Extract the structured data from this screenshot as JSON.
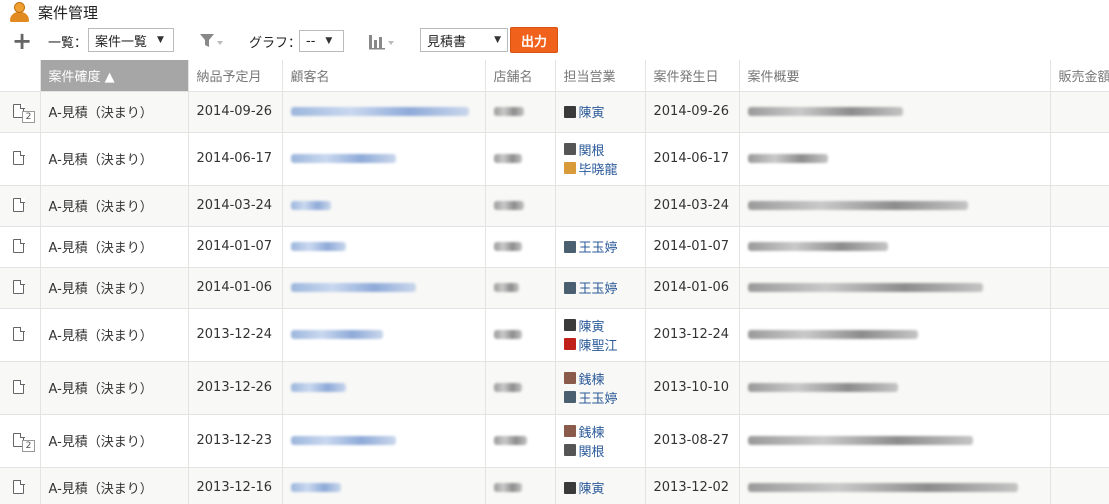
{
  "app": {
    "title": "案件管理",
    "icon": "app-person-icon"
  },
  "toolbar": {
    "add_icon": "plus-icon",
    "view_label": "一覧：",
    "view_value": "案件一覧",
    "filter_icon": "filter-icon",
    "graph_label": "グラフ：",
    "graph_value": "--",
    "chart_icon": "bar-chart-icon",
    "report_value": "見積書",
    "export_label": "出力",
    "export_color": "#f0621b"
  },
  "table": {
    "columns": [
      {
        "key": "icon",
        "label": ""
      },
      {
        "key": "rank",
        "label": "案件確度 ▲",
        "sorted": true
      },
      {
        "key": "delivery",
        "label": "納品予定月"
      },
      {
        "key": "customer",
        "label": "顧客名"
      },
      {
        "key": "store",
        "label": "店舗名"
      },
      {
        "key": "sales",
        "label": "担当営業"
      },
      {
        "key": "occurred",
        "label": "案件発生日"
      },
      {
        "key": "summary",
        "label": "案件概要"
      },
      {
        "key": "amount",
        "label": "販売金額"
      }
    ],
    "rows": [
      {
        "attachments": "2",
        "rank": "A-見積（決まり）",
        "delivery": "2014-09-26",
        "sales": [
          {
            "name": "陳寅",
            "avatar": "#3a3a3a"
          }
        ],
        "occurred": "2014-09-26"
      },
      {
        "attachments": "",
        "rank": "A-見積（決まり）",
        "delivery": "2014-06-17",
        "sales": [
          {
            "name": "関根",
            "avatar": "#555555"
          },
          {
            "name": "毕晓龍",
            "avatar": "#d99a3a"
          }
        ],
        "occurred": "2014-06-17"
      },
      {
        "attachments": "",
        "rank": "A-見積（決まり）",
        "delivery": "2014-03-24",
        "sales": [],
        "occurred": "2014-03-24"
      },
      {
        "attachments": "",
        "rank": "A-見積（決まり）",
        "delivery": "2014-01-07",
        "sales": [
          {
            "name": "王玉婷",
            "avatar": "#4a6070"
          }
        ],
        "occurred": "2014-01-07"
      },
      {
        "attachments": "",
        "rank": "A-見積（決まり）",
        "delivery": "2014-01-06",
        "sales": [
          {
            "name": "王玉婷",
            "avatar": "#4a6070"
          }
        ],
        "occurred": "2014-01-06"
      },
      {
        "attachments": "",
        "rank": "A-見積（決まり）",
        "delivery": "2013-12-24",
        "sales": [
          {
            "name": "陳寅",
            "avatar": "#3a3a3a"
          },
          {
            "name": "陳聖江",
            "avatar": "#c0201a"
          }
        ],
        "occurred": "2013-12-24"
      },
      {
        "attachments": "",
        "rank": "A-見積（決まり）",
        "delivery": "2013-12-26",
        "sales": [
          {
            "name": "銭楝",
            "avatar": "#8a5a4a"
          },
          {
            "name": "王玉婷",
            "avatar": "#4a6070"
          }
        ],
        "occurred": "2013-10-10"
      },
      {
        "attachments": "2",
        "rank": "A-見積（決まり）",
        "delivery": "2013-12-23",
        "sales": [
          {
            "name": "銭楝",
            "avatar": "#8a5a4a"
          },
          {
            "name": "関根",
            "avatar": "#555555"
          }
        ],
        "occurred": "2013-08-27"
      },
      {
        "attachments": "",
        "rank": "A-見積（決まり）",
        "delivery": "2013-12-16",
        "sales": [
          {
            "name": "陳寅",
            "avatar": "#3a3a3a"
          }
        ],
        "occurred": "2013-12-02"
      }
    ]
  }
}
